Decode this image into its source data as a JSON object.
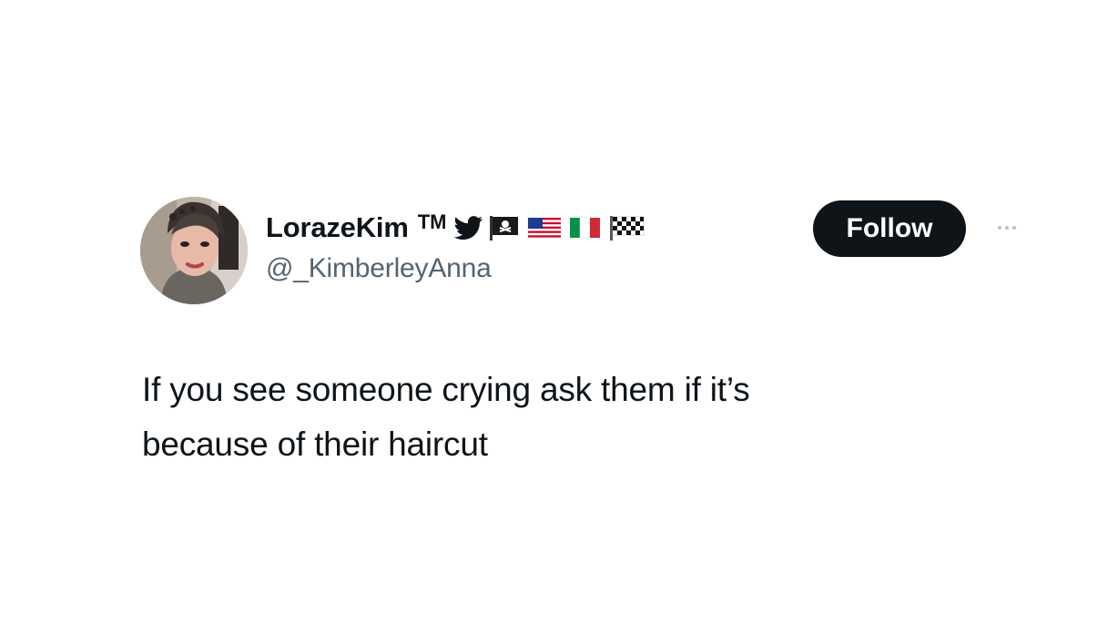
{
  "user": {
    "display_name": "LorazeKim",
    "trademark": "TM",
    "handle": "@_KimberleyAnna",
    "avatar_alt": "profile photo"
  },
  "badges": [
    {
      "icon": "twitter-bird-icon"
    },
    {
      "icon": "pirate-flag-icon"
    },
    {
      "icon": "us-flag-icon"
    },
    {
      "icon": "italy-flag-icon"
    },
    {
      "icon": "checkered-flag-icon"
    }
  ],
  "actions": {
    "follow_label": "Follow",
    "more_icon": "more-options-icon"
  },
  "tweet": {
    "text": "If you see someone crying ask them if it’s\nbecause of their haircut"
  },
  "colors": {
    "text": "#0f1419",
    "secondary_text": "#536471",
    "follow_bg": "#0f1419",
    "follow_text": "#ffffff",
    "background": "#ffffff"
  }
}
